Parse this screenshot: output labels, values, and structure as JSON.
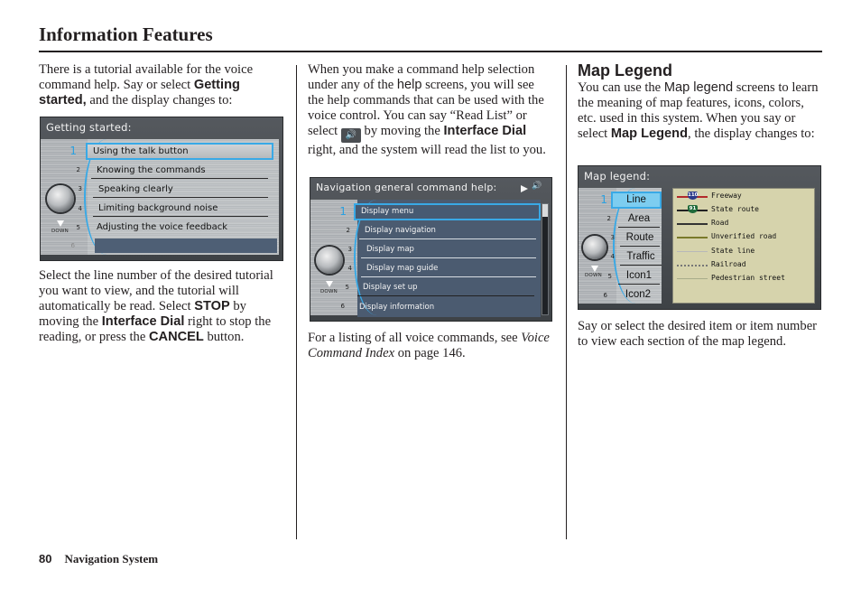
{
  "header": {
    "title": "Information Features"
  },
  "footer": {
    "page_number": "80",
    "section": "Navigation System"
  },
  "col1": {
    "intro": {
      "t1": "There is a tutorial available for the voice command help. Say or select ",
      "b1": "Getting started,",
      "t2": " and the display changes to:"
    },
    "screen": {
      "title": "Getting started:",
      "down_label": "DOWN",
      "items": [
        {
          "num": "1",
          "label": "Using the talk button"
        },
        {
          "num": "2",
          "label": "Knowing the commands"
        },
        {
          "num": "3",
          "label": "Speaking clearly"
        },
        {
          "num": "4",
          "label": "Limiting background noise"
        },
        {
          "num": "5",
          "label": "Adjusting the voice feedback"
        },
        {
          "num": "6",
          "label": ""
        }
      ]
    },
    "body": {
      "t1": "Select the line number of the desired tutorial you want to view, and the tutorial will automatically be read. Select ",
      "b1": "STOP",
      "t2": " by moving the ",
      "b2": "Interface Dial",
      "t3": " right to stop the reading, or press the ",
      "b3": "CANCEL",
      "t4": " button."
    }
  },
  "col2": {
    "intro": {
      "t1": "When you make a command help selection under any of the ",
      "s1": "help",
      "t2": " screens, you will see the help commands that can be used with the voice control. You can say “Read List” or select ",
      "icon": "speaker-icon",
      "t3": " by moving the ",
      "b1": "Interface Dial",
      "t4": " right, and the system will read the list to you."
    },
    "screen": {
      "title": "Navigation general command help:",
      "down_label": "DOWN",
      "items": [
        {
          "num": "1",
          "label": "Display menu"
        },
        {
          "num": "2",
          "label": "Display navigation"
        },
        {
          "num": "3",
          "label": "Display map"
        },
        {
          "num": "4",
          "label": "Display map guide"
        },
        {
          "num": "5",
          "label": "Display set up"
        },
        {
          "num": "6",
          "label": "Display information"
        }
      ]
    },
    "footnote": {
      "t1": "For a listing of all voice commands, see ",
      "i1": "Voice Command Index",
      "t2": " on page 146."
    }
  },
  "col3": {
    "heading": "Map Legend",
    "intro": {
      "t1": "You can use the ",
      "s1": "Map legend",
      "t2": " screens to learn the meaning of map features, icons, colors, etc. used in this system. When you say or select ",
      "b1": "Map Legend",
      "t3": ", the display changes to:"
    },
    "screen": {
      "title": "Map legend:",
      "down_label": "DOWN",
      "tabs": [
        {
          "num": "1",
          "label": "Line"
        },
        {
          "num": "2",
          "label": "Area"
        },
        {
          "num": "3",
          "label": "Route"
        },
        {
          "num": "4",
          "label": "Traffic"
        },
        {
          "num": "5",
          "label": "Icon1"
        },
        {
          "num": "6",
          "label": "Icon2"
        }
      ],
      "legend": [
        {
          "label": "Freeway",
          "color": "#b22a2a",
          "shield": "110",
          "shield_color": "#2a3a8a"
        },
        {
          "label": "State route",
          "color": "#222222",
          "shield": "91",
          "shield_color": "#1f6a3a"
        },
        {
          "label": "Road",
          "color": "#333333"
        },
        {
          "label": "Unverified road",
          "color": "#7a7a2a"
        },
        {
          "label": "State line",
          "color": "#b8b8b8"
        },
        {
          "label": "Railroad",
          "color": "#777777"
        },
        {
          "label": "Pedestrian street",
          "color": "#a8ad8a"
        }
      ]
    },
    "body": "Say or select the desired item or item number to view each section of the map legend."
  }
}
